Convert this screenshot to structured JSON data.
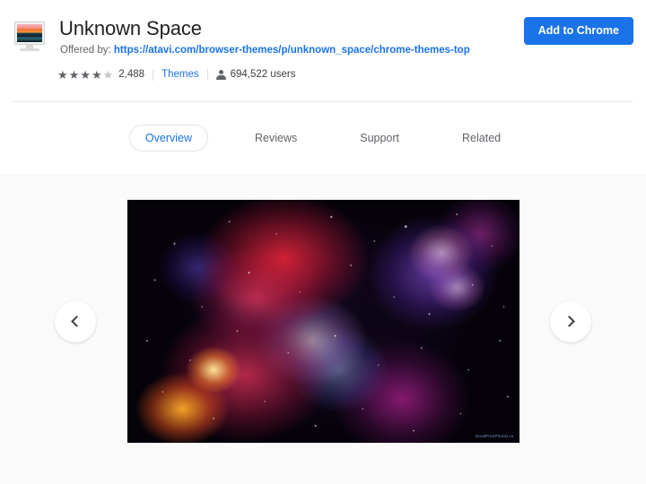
{
  "header": {
    "title": "Unknown Space",
    "offered_by_label": "Offered by:",
    "offered_by_url": "https://atavi.com/browser-themes/p/unknown_space/chrome-themes-top",
    "add_button_label": "Add to Chrome",
    "icon_name": "monitor-theme-icon"
  },
  "rating": {
    "stars_filled": 4,
    "stars_total": 5,
    "count": "2,488",
    "category_label": "Themes",
    "users_count": "694,522 users"
  },
  "tabs": [
    {
      "label": "Overview",
      "active": true
    },
    {
      "label": "Reviews",
      "active": false
    },
    {
      "label": "Support",
      "active": false
    },
    {
      "label": "Related",
      "active": false
    }
  ],
  "carousel": {
    "prev_label": "‹",
    "next_label": "›",
    "screenshot_alt": "Unknown Space nebula theme preview",
    "watermark": "GoodFreePhotos.ru"
  },
  "colors": {
    "accent": "#1a73e8",
    "text_primary": "#212121",
    "text_secondary": "#5f6368",
    "content_bg": "#fafafa",
    "divider": "#ececec"
  }
}
